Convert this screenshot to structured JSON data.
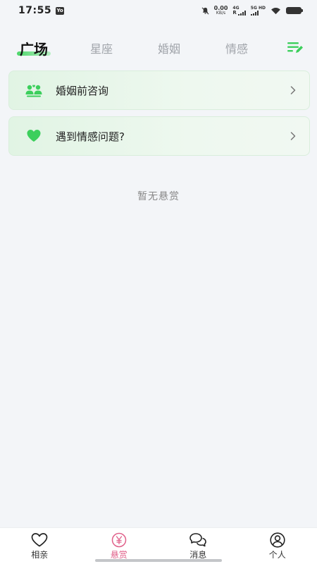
{
  "status_bar": {
    "time": "17:55",
    "app_badge": "Yo",
    "net_speed_value": "0.00",
    "net_speed_unit": "KB/s",
    "signal1_label": "4G",
    "signal1_sub": "R",
    "signal2_label": "5G HD"
  },
  "tabs": [
    {
      "label": "广场",
      "active": true
    },
    {
      "label": "星座",
      "active": false
    },
    {
      "label": "婚姻",
      "active": false
    },
    {
      "label": "情感",
      "active": false
    }
  ],
  "cards": [
    {
      "label": "婚姻前咨询",
      "icon": "people-icon"
    },
    {
      "label": "遇到情感问题?",
      "icon": "heart-icon"
    }
  ],
  "empty_text": "暂无悬赏",
  "bottom_nav": [
    {
      "label": "相亲",
      "icon": "heart-outline-icon",
      "active": false
    },
    {
      "label": "悬赏",
      "icon": "yen-coin-icon",
      "active": true
    },
    {
      "label": "消息",
      "icon": "chat-bubbles-icon",
      "active": false
    },
    {
      "label": "个人",
      "icon": "user-circle-icon",
      "active": false
    }
  ],
  "colors": {
    "accent_green": "#3ccf5c",
    "active_pink": "#e0608a",
    "background": "#f3f5f8"
  }
}
